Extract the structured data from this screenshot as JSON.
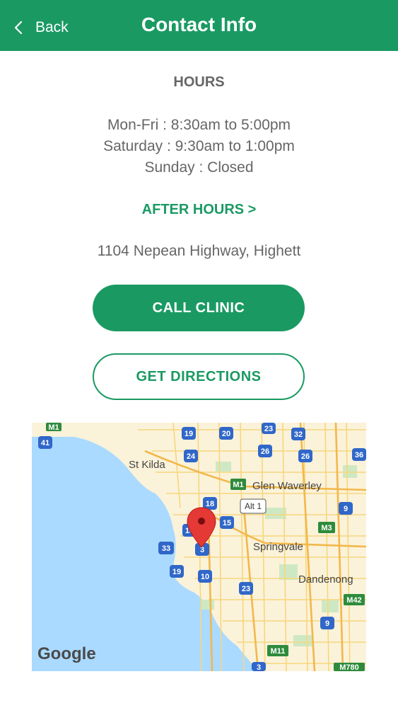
{
  "header": {
    "back_label": "Back",
    "title": "Contact Info"
  },
  "hours": {
    "title": "HOURS",
    "lines": [
      "Mon-Fri : 8:30am to 5:00pm",
      "Saturday : 9:30am to 1:00pm",
      "Sunday : Closed"
    ]
  },
  "after_hours_label": "AFTER HOURS >",
  "address": "1104 Nepean Highway, Highett",
  "buttons": {
    "call": "CALL CLINIC",
    "directions": "GET DIRECTIONS"
  },
  "map": {
    "places": [
      "St Kilda",
      "Glen Waverley",
      "Springvale",
      "Dandenong"
    ],
    "route_labels": [
      "M1",
      "41",
      "19",
      "20",
      "23",
      "32",
      "24",
      "26",
      "26",
      "36",
      "M1",
      "18",
      "Alt 1",
      "9",
      "14",
      "15",
      "M3",
      "33",
      "3",
      "19",
      "10",
      "23",
      "M42",
      "9",
      "M11",
      "3",
      "M780"
    ],
    "attribution": "Google"
  },
  "colors": {
    "brand_green": "#1a9a62",
    "text_gray": "#666666",
    "water": "#aadaff",
    "land": "#fbf2da",
    "pin_red": "#e53935"
  }
}
